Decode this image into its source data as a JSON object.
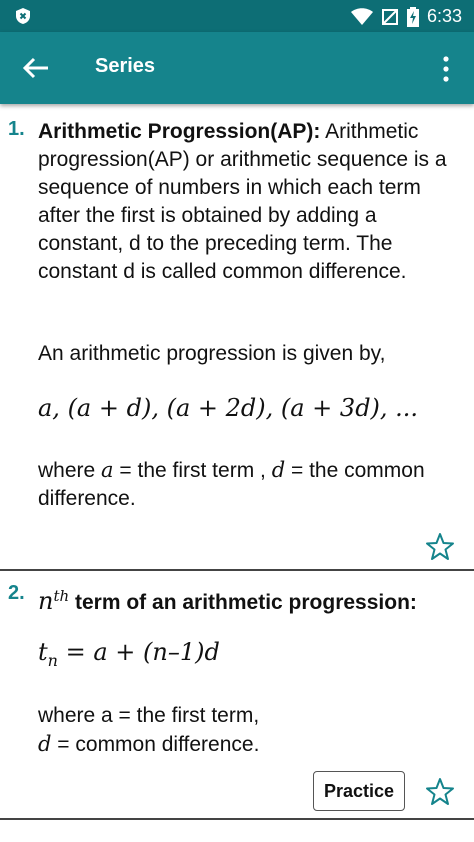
{
  "status": {
    "time": "6:33"
  },
  "appbar": {
    "title": "Series"
  },
  "items": [
    {
      "number": "1.",
      "heading": "Arithmetic Progression(AP):",
      "body": "Arithmetic progression(AP) or arithmetic sequence is a sequence of numbers in which each term after the first is obtained by adding a constant, d to the preceding term. The constant d is called common difference.",
      "intro": "An arithmetic progression is given by,",
      "formula": "a, (a + d), (a + 2d), (a + 3d), ...",
      "where_prefix": "where ",
      "var_a": "a",
      "where_mid": " = the first term , ",
      "var_d": "d",
      "where_suffix": " = the common difference."
    },
    {
      "number": "2.",
      "heading_var": "n",
      "heading_sup": "th",
      "heading": " term of an arithmetic progression:",
      "formula": "t",
      "formula_sub": "n",
      "formula_rest": " = a + (n–1)d",
      "where_line1": "where a = the first term,",
      "var_d": "d",
      "where_line2": " = common difference.",
      "practice_label": "Practice"
    }
  ]
}
